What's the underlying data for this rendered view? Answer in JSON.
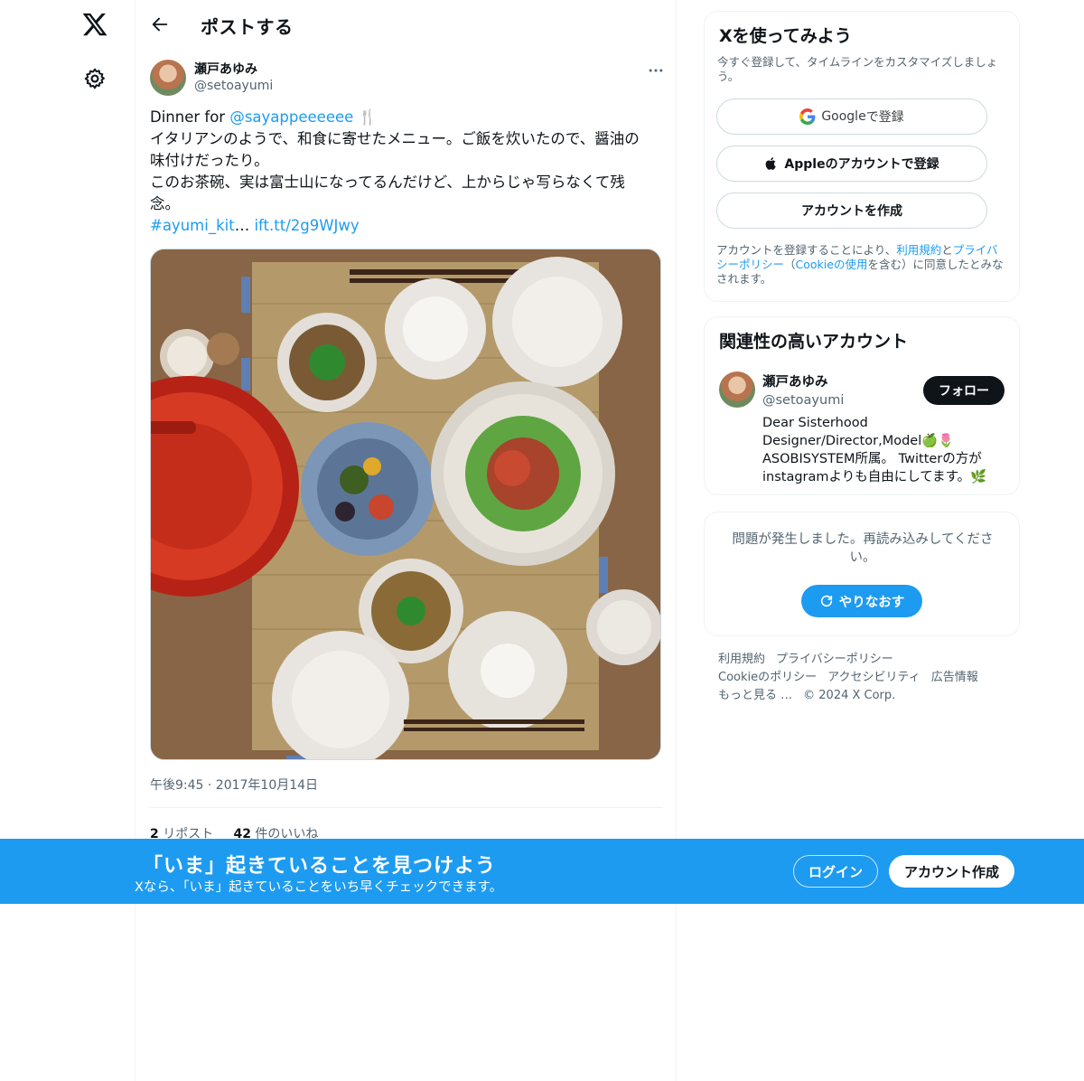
{
  "nav": {
    "logo_icon": "x-logo-icon",
    "settings_icon": "gear-icon"
  },
  "header": {
    "title": "ポストする"
  },
  "post": {
    "author_name": "瀬戸あゆみ",
    "author_handle": "@setoayumi",
    "text_prefix": "Dinner for ",
    "mention": "@sayappeeeeee",
    "emoji": "🍴",
    "line2": "イタリアンのようで、和食に寄せたメニュー。ご飯を炊いたので、醤油の",
    "line3": "味付けだったり。",
    "line4": "このお茶碗、実は富士山になってるんだけど、上からじゃ写らなくて残",
    "line5": "念。",
    "hashtag": "#ayumi_kit",
    "ellipsis": "… ",
    "short_link": "ift.tt/2g9WJwy",
    "timestamp": "午後9:45 · 2017年10月14日",
    "reposts_count": "2",
    "reposts_label": " リポスト",
    "likes_count": "42",
    "likes_label": " 件のいいね"
  },
  "signup_card": {
    "title": "Xを使ってみよう",
    "subtitle": "今すぐ登録して、タイムラインをカスタマイズしましょう。",
    "google_brand": "Google",
    "google_suffix": " で登録",
    "apple_label": "Appleのアカウントで登録",
    "create_label": "アカウントを作成",
    "legal_1": "アカウントを登録することにより、",
    "legal_terms": "利用規約",
    "legal_2": "と",
    "legal_privacy": "プライバシーポリシー",
    "legal_3": "（",
    "legal_cookie": "Cookieの使用",
    "legal_4": "を含む）に同意したとみなされます。"
  },
  "relevant": {
    "title": "関連性の高いアカウント",
    "name": "瀬戸あゆみ",
    "handle": "@setoayumi",
    "follow_label": "フォロー",
    "bio_1": "Dear Sisterhood",
    "bio_2": "Designer/Director,Model🍏🌷",
    "bio_3": "ASOBISYSTEM所属。 Twitterの方が",
    "bio_4": "instagramよりも自由にしてます。🌿"
  },
  "error_card": {
    "message": "問題が発生しました。再読み込みしてください。",
    "retry_label": "やりなおす"
  },
  "footer": {
    "terms": "利用規約",
    "privacy": "プライバシーポリシー",
    "cookie": "Cookieのポリシー",
    "accessibility": "アクセシビリティ",
    "ads": "広告情報",
    "more": "もっと見る …",
    "copyright": "© 2024 X Corp."
  },
  "banner": {
    "title": "「いま」起きていることを見つけよう",
    "subtitle": "Xなら、「いま」起きていることをいち早くチェックできます。",
    "login_label": "ログイン",
    "signup_label": "アカウント作成"
  },
  "colors": {
    "accent": "#1d9bf0",
    "text": "#0f1419",
    "secondary": "#536471",
    "border": "#eff3f4"
  }
}
